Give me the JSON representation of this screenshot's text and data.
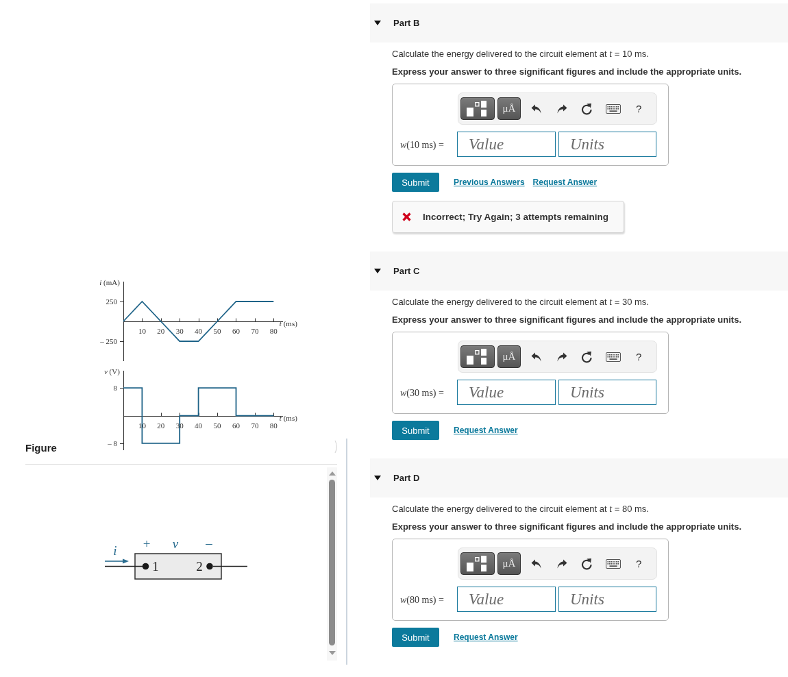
{
  "figure": {
    "label": "Figure",
    "current_graph": {
      "chart_data": {
        "type": "line",
        "xlabel": "*t* (ms)",
        "ylabel": "*i* (mA)",
        "x": [
          0,
          10,
          20,
          30,
          40,
          50,
          60,
          80
        ],
        "series": [
          {
            "color": "#1e6388",
            "values": [
              0,
              250,
              0,
              -250,
              -250,
              0,
              250,
              250
            ]
          }
        ],
        "xlim": [
          0,
          85
        ],
        "ylim": [
          -500,
          500
        ],
        "xticks": [
          10,
          20,
          30,
          40,
          50,
          60,
          70,
          80
        ],
        "yticks": [
          {
            "value": 250,
            "label": "250"
          },
          {
            "value": -250,
            "label": "– 250"
          }
        ]
      }
    },
    "voltage_graph": {
      "chart_data": {
        "type": "line",
        "xlabel": "*t* (ms)",
        "ylabel": "*v* (V)",
        "x": [
          0,
          10,
          10,
          30,
          30,
          40,
          40,
          60,
          60,
          80
        ],
        "series": [
          {
            "color": "#1e6388",
            "values": [
              8,
              8,
              -8,
              -8,
              0,
              0,
              8,
              8,
              0,
              0
            ]
          }
        ],
        "xlim": [
          0,
          85
        ],
        "ylim": [
          -10,
          13
        ],
        "xticks": [
          10,
          20,
          30,
          40,
          50,
          60,
          70,
          80
        ],
        "yticks": [
          {
            "value": 8,
            "label": "8"
          },
          {
            "value": -8,
            "label": "– 8"
          }
        ]
      }
    },
    "circuit": {
      "current_label": "i",
      "plus_sign": "+",
      "voltage_label": "v",
      "minus_sign": "–",
      "terminal_1": "1",
      "terminal_2": "2"
    }
  },
  "parts": [
    {
      "title": "Part B",
      "expanded": true,
      "question": "Calculate the energy delivered to the circuit element at *t* = 10 ms.",
      "instruction": "Express your answer to three significant figures and include the appropriate units.",
      "toolbar": {
        "units_button": "μÅ",
        "help_button": "?"
      },
      "answer_label": "*w*(10 ms) =",
      "value_field": {
        "placeholder": "Value"
      },
      "units_field": {
        "placeholder": "Units"
      },
      "submit": "Submit",
      "links": [
        "Previous Answers",
        "Request Answer"
      ],
      "feedback": {
        "kind": "incorrect",
        "text": "Incorrect; Try Again; 3 attempts remaining"
      }
    },
    {
      "title": "Part C",
      "expanded": true,
      "question": "Calculate the energy delivered to the circuit element at *t* = 30 ms.",
      "instruction": "Express your answer to three significant figures and include the appropriate units.",
      "toolbar": {
        "units_button": "μÅ",
        "help_button": "?"
      },
      "answer_label": "*w*(30 ms) =",
      "value_field": {
        "placeholder": "Value"
      },
      "units_field": {
        "placeholder": "Units"
      },
      "submit": "Submit",
      "links": [
        "Request Answer"
      ]
    },
    {
      "title": "Part D",
      "expanded": true,
      "question": "Calculate the energy delivered to the circuit element at *t* = 80 ms.",
      "instruction": "Express your answer to three significant figures and include the appropriate units.",
      "toolbar": {
        "units_button": "μÅ",
        "help_button": "?"
      },
      "answer_label": "*w*(80 ms) =",
      "value_field": {
        "placeholder": "Value"
      },
      "units_field": {
        "placeholder": "Units"
      },
      "submit": "Submit",
      "links": [
        "Request Answer"
      ]
    }
  ]
}
